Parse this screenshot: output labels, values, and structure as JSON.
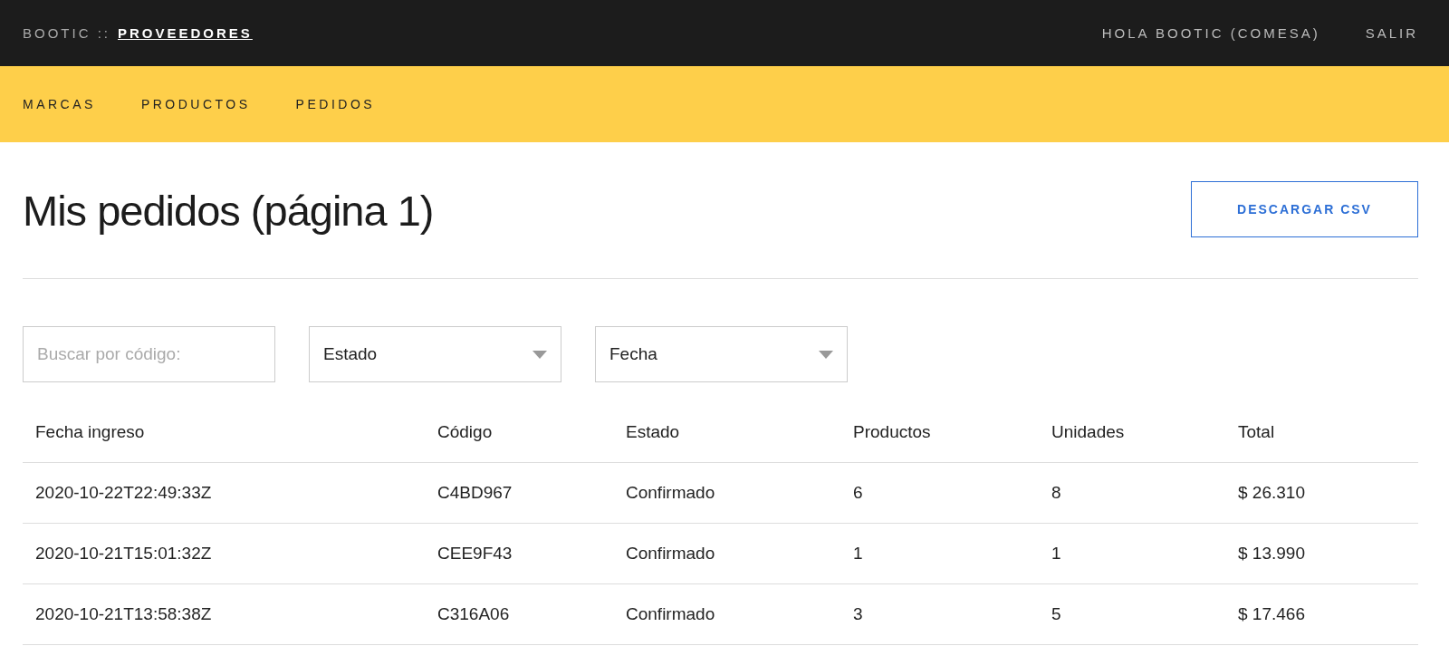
{
  "header": {
    "brand": "BOOTIC ::",
    "section": "PROVEEDORES",
    "greeting": "HOLA BOOTIC (COMESA)",
    "logout": "SALIR"
  },
  "nav": [
    "MARCAS",
    "PRODUCTOS",
    "PEDIDOS"
  ],
  "page": {
    "title": "Mis pedidos (página 1)",
    "download_button": "DESCARGAR CSV"
  },
  "filters": {
    "search": {
      "placeholder": "Buscar por código:"
    },
    "selects": [
      {
        "value": "Estado"
      },
      {
        "value": "Fecha"
      }
    ]
  },
  "table": {
    "columns": [
      "Fecha ingreso",
      "Código",
      "Estado",
      "Productos",
      "Unidades",
      "Total"
    ],
    "rows": [
      [
        "2020-10-22T22:49:33Z",
        "C4BD967",
        "Confirmado",
        "6",
        "8",
        "$ 26.310"
      ],
      [
        "2020-10-21T15:01:32Z",
        "CEE9F43",
        "Confirmado",
        "1",
        "1",
        "$ 13.990"
      ],
      [
        "2020-10-21T13:58:38Z",
        "C316A06",
        "Confirmado",
        "3",
        "5",
        "$ 17.466"
      ]
    ]
  }
}
